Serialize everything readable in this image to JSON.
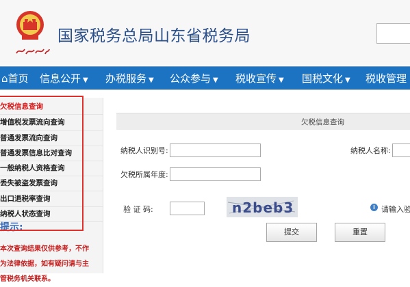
{
  "header": {
    "site_title": "国家税务总局山东省税务局",
    "logo_signature": "中国税务"
  },
  "nav": {
    "items": [
      {
        "label": "首页",
        "icon": "home-icon"
      },
      {
        "label": "信息公开",
        "has_dropdown": true
      },
      {
        "label": "办税服务",
        "has_dropdown": true
      },
      {
        "label": "公众参与",
        "has_dropdown": true
      },
      {
        "label": "税收宣传",
        "has_dropdown": true
      },
      {
        "label": "国税文化",
        "has_dropdown": true
      },
      {
        "label": "税收管理",
        "has_dropdown": false
      }
    ]
  },
  "sidebar": {
    "items": [
      {
        "label": "欠税信息查询",
        "active": true
      },
      {
        "label": "增值税发票流向查询"
      },
      {
        "label": "普通发票流向查询"
      },
      {
        "label": "普通发票信息比对查询"
      },
      {
        "label": "一般纳税人资格查询"
      },
      {
        "label": "丢失被盗发票查询"
      },
      {
        "label": "出口退税率查询"
      },
      {
        "label": "纳税人状态查询"
      }
    ],
    "hint_title": "提示:",
    "hint_lines": [
      "本次查询结果仅供参考，不作",
      "为法律依据，如有疑问请与主",
      "管税务机关联系。"
    ]
  },
  "form": {
    "panel_title": "欠税信息查询",
    "taxpayer_id_label": "纳税人识别号:",
    "taxpayer_id_value": "",
    "taxpayer_name_label": "纳税人名称:",
    "taxpayer_name_value": "",
    "year_label": "欠税所属年度:",
    "year_value": "",
    "captcha_label": "验 证 码:",
    "captcha_value": "",
    "captcha_text": "n2beb3",
    "captcha_hint": "请输入验",
    "submit_label": "提交",
    "reset_label": "重置"
  },
  "colors": {
    "nav_bg": "#1c73c2",
    "active_item": "#d71a1a",
    "title_blue": "#2a4f8a",
    "highlight_frame": "#e0302c"
  }
}
